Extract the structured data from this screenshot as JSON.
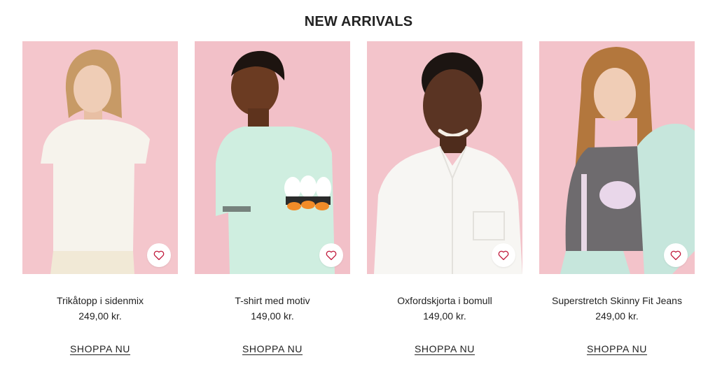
{
  "section": {
    "title": "NEW ARRIVALS"
  },
  "colors": {
    "backdrop_pink": "#f3c3c9",
    "heart_red": "#c0183a",
    "text": "#222222"
  },
  "products": [
    {
      "name": "Trikåtopp i sidenmix",
      "price": "249,00 kr.",
      "cta": "SHOPPA NU",
      "image": "model-in-white-top",
      "icon": "heart-outline-icon"
    },
    {
      "name": "T-shirt med motiv",
      "price": "149,00 kr.",
      "cta": "SHOPPA NU",
      "image": "model-in-mint-t-shirt",
      "icon": "heart-outline-icon"
    },
    {
      "name": "Oxfordskjorta i bomull",
      "price": "149,00 kr.",
      "cta": "SHOPPA NU",
      "image": "model-in-white-oxford-shirt",
      "icon": "heart-outline-icon"
    },
    {
      "name": "Superstretch Skinny Fit Jeans",
      "price": "249,00 kr.",
      "cta": "SHOPPA NU",
      "image": "model-in-grey-sweater-and-mint-jeans",
      "icon": "heart-outline-icon"
    }
  ]
}
